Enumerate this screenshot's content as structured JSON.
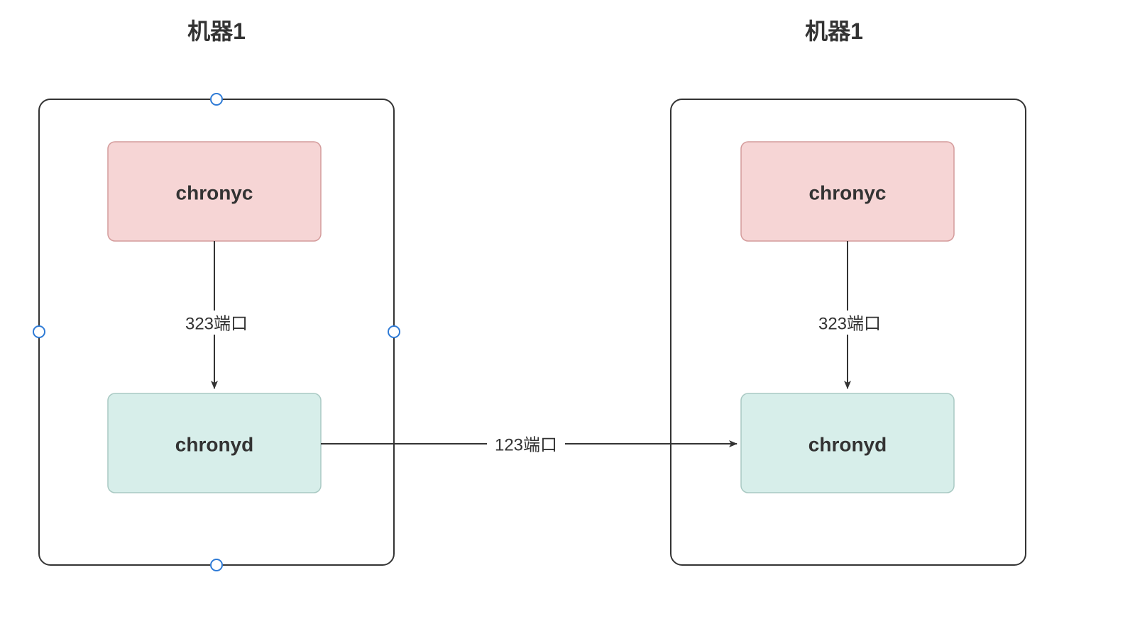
{
  "machine1": {
    "title": "机器1",
    "chronyc_label": "chronyc",
    "chronyd_label": "chronyd",
    "internal_edge_label": "323端口"
  },
  "machine2": {
    "title": "机器1",
    "chronyc_label": "chronyc",
    "chronyd_label": "chronyd",
    "internal_edge_label": "323端口"
  },
  "cross_edge_label": "123端口",
  "colors": {
    "chronyc_fill": "#f6d5d5",
    "chronyc_stroke": "#d49b9b",
    "chronyd_fill": "#d7eeea",
    "chronyd_stroke": "#a9c9c3",
    "selection_handle": "#2f7bd6"
  }
}
